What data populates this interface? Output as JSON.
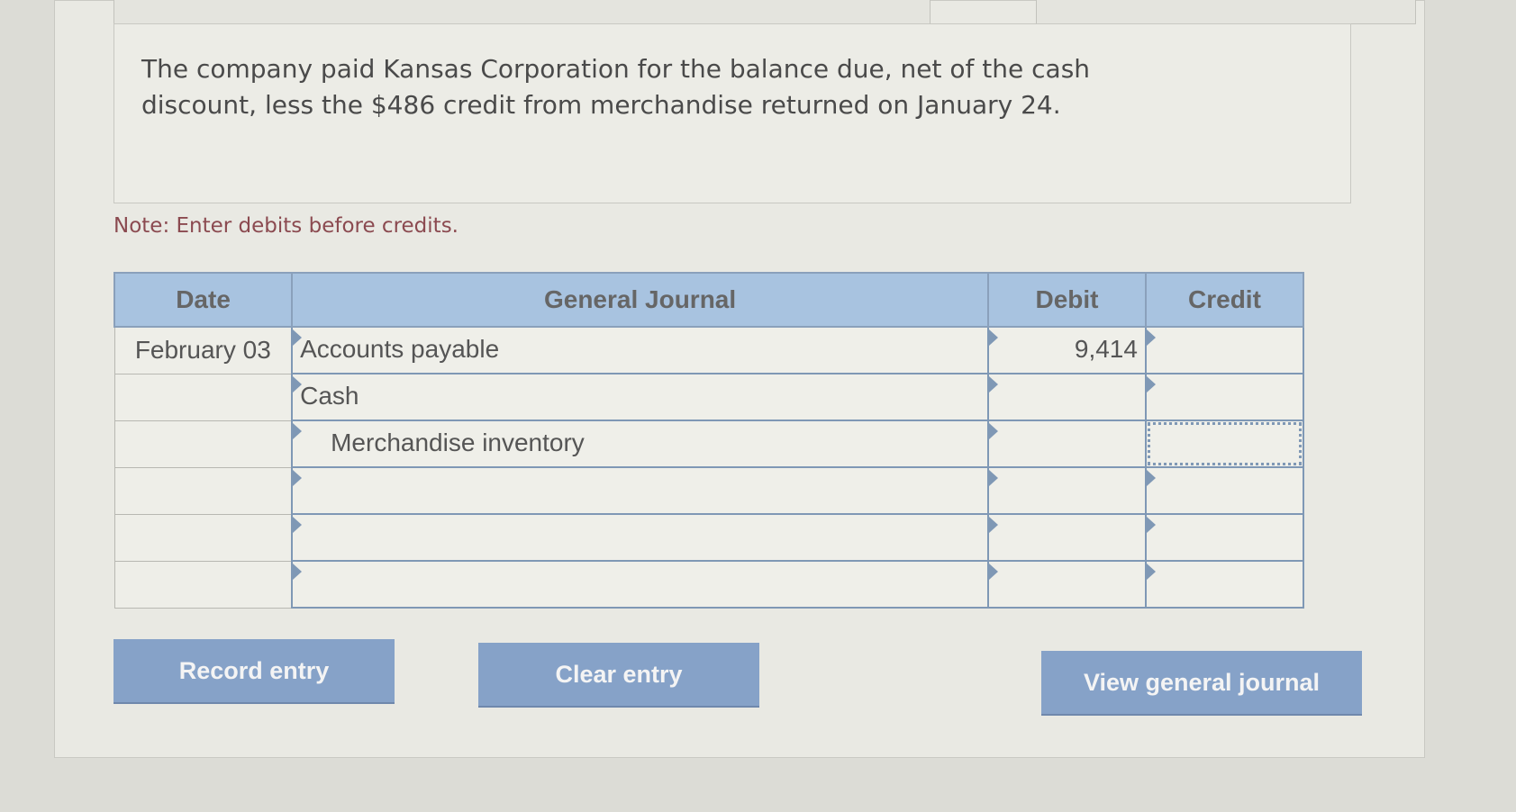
{
  "prompt": {
    "text": "The company paid Kansas Corporation for the balance due, net of the cash discount, less the $486 credit from merchandise returned on January 24."
  },
  "note": "Note: Enter debits before credits.",
  "journal": {
    "headers": {
      "date": "Date",
      "account": "General Journal",
      "debit": "Debit",
      "credit": "Credit"
    },
    "rows": [
      {
        "date": "February 03",
        "account": "Accounts payable",
        "debit": "9,414",
        "credit": ""
      },
      {
        "date": "",
        "account": "Cash",
        "debit": "",
        "credit": ""
      },
      {
        "date": "",
        "account": "Merchandise inventory",
        "debit": "",
        "credit": ""
      },
      {
        "date": "",
        "account": "",
        "debit": "",
        "credit": ""
      },
      {
        "date": "",
        "account": "",
        "debit": "",
        "credit": ""
      },
      {
        "date": "",
        "account": "",
        "debit": "",
        "credit": ""
      }
    ]
  },
  "buttons": {
    "record": "Record entry",
    "clear": "Clear entry",
    "view": "View general journal"
  }
}
